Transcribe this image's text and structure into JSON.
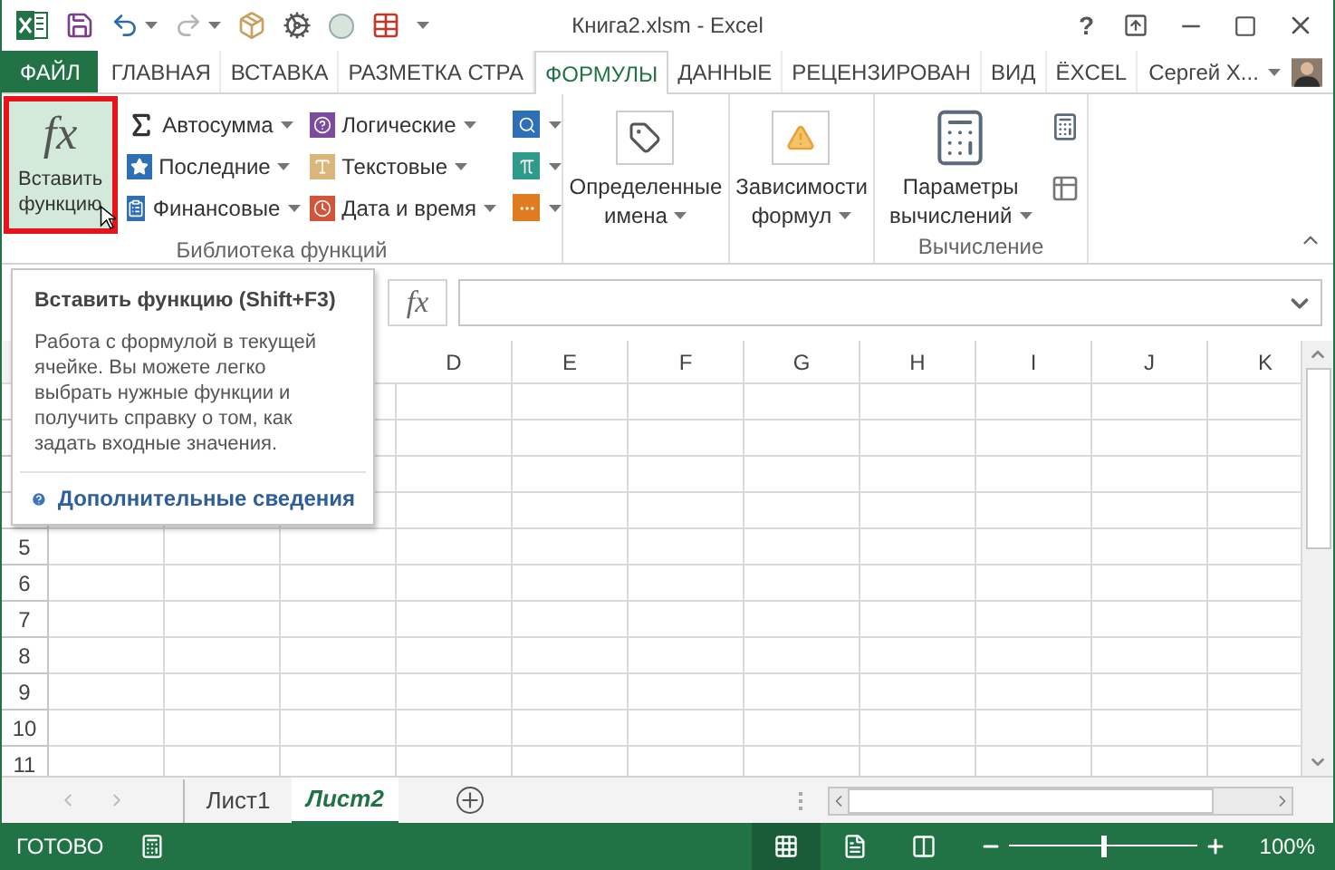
{
  "window": {
    "title": "Книга2.xlsm - Excel",
    "help": "?"
  },
  "tabs": [
    {
      "label": "ФАЙЛ",
      "kind": "file",
      "selected": false
    },
    {
      "label": "ГЛАВНАЯ",
      "kind": "tab",
      "selected": false
    },
    {
      "label": "ВСТАВКА",
      "kind": "tab",
      "selected": false
    },
    {
      "label": "РАЗМЕТКА СТРА",
      "kind": "tab",
      "selected": false
    },
    {
      "label": "ФОРМУЛЫ",
      "kind": "tab",
      "selected": true
    },
    {
      "label": "ДАННЫЕ",
      "kind": "tab",
      "selected": false
    },
    {
      "label": "РЕЦЕНЗИРОВАН",
      "kind": "tab",
      "selected": false
    },
    {
      "label": "ВИД",
      "kind": "tab",
      "selected": false
    },
    {
      "label": "ЁXCEL",
      "kind": "tab",
      "selected": false
    }
  ],
  "user": {
    "name": "Сергей Х..."
  },
  "ribbon": {
    "insert_function": {
      "icon_text": "fx",
      "label": "Вставить функцию",
      "highlighted": true
    },
    "functions": [
      {
        "label": "Автосумма",
        "kind": "sum"
      },
      {
        "label": "Последние",
        "kind": "recent"
      },
      {
        "label": "Финансовые",
        "kind": "finance"
      },
      {
        "label": "Логические",
        "kind": "logic"
      },
      {
        "label": "Текстовые",
        "kind": "text"
      },
      {
        "label": "Дата и время",
        "kind": "date"
      }
    ],
    "library_label": "Библиотека функций",
    "big_buttons": [
      {
        "kind": "names",
        "lines": [
          "Определенные",
          "имена"
        ]
      },
      {
        "kind": "audit",
        "lines": [
          "Зависимости",
          "формул"
        ]
      },
      {
        "kind": "calc",
        "lines": [
          "Параметры",
          "вычислений"
        ]
      }
    ],
    "calc_label": "Вычисление"
  },
  "formula_bar": {
    "fx": "fx"
  },
  "tooltip": {
    "title": "Вставить функцию (Shift+F3)",
    "body": "Работа с формулой в текущей ячейке. Вы можете легко выбрать нужные функции и получить справку о том, как задать входные значения.",
    "link": "Дополнительные сведения"
  },
  "columns": [
    "D",
    "E",
    "F",
    "G",
    "H",
    "I",
    "J",
    "K"
  ],
  "rows": [
    "5",
    "6",
    "7",
    "8",
    "9",
    "10",
    "11"
  ],
  "sheets": [
    {
      "label": "Лист1",
      "selected": false
    },
    {
      "label": "Лист2",
      "selected": true
    }
  ],
  "status_bar": {
    "text": "ГОТОВО",
    "views": [
      {
        "kind": "normal",
        "selected": true
      },
      {
        "kind": "layout",
        "selected": false
      },
      {
        "kind": "break",
        "selected": false
      }
    ],
    "zoom": {
      "level": 0.5,
      "reading": "100%"
    }
  }
}
